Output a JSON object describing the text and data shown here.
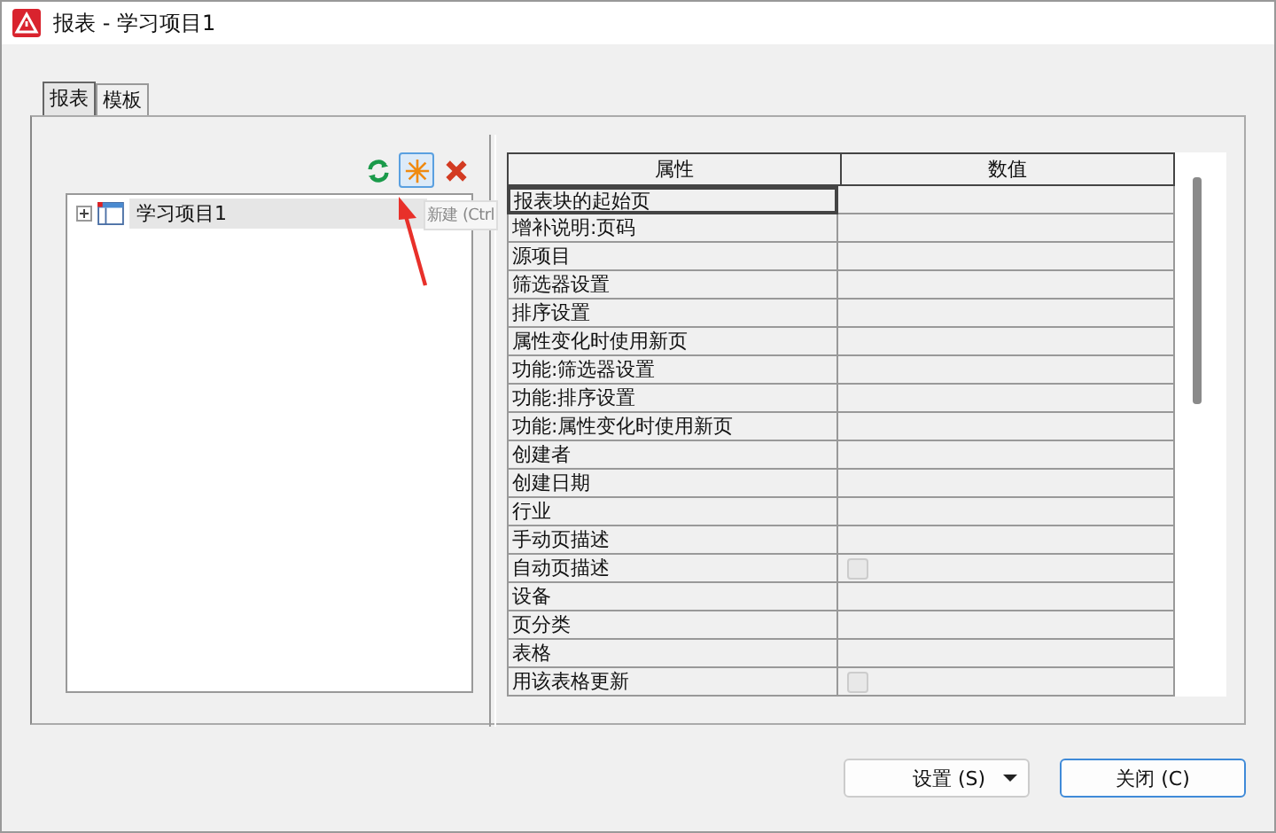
{
  "window": {
    "title": "报表 - 学习项目1"
  },
  "tabs": [
    {
      "label": "报表",
      "selected": true
    },
    {
      "label": "模板",
      "selected": false
    }
  ],
  "toolbar": {
    "tooltip": "新建 (Ctrl"
  },
  "tree": {
    "items": [
      {
        "label": "学习项目1",
        "expanded": false,
        "selected": true
      }
    ]
  },
  "table": {
    "columns": [
      "属性",
      "数值"
    ],
    "rows": [
      {
        "name": "报表块的起始页",
        "kind": "text",
        "selected": true
      },
      {
        "name": "增补说明:页码",
        "kind": "text",
        "selected": false
      },
      {
        "name": "源项目",
        "kind": "text",
        "selected": false
      },
      {
        "name": "筛选器设置",
        "kind": "text",
        "selected": false
      },
      {
        "name": "排序设置",
        "kind": "text",
        "selected": false
      },
      {
        "name": "属性变化时使用新页",
        "kind": "text",
        "selected": false
      },
      {
        "name": "功能:筛选器设置",
        "kind": "text",
        "selected": false
      },
      {
        "name": "功能:排序设置",
        "kind": "text",
        "selected": false
      },
      {
        "name": "功能:属性变化时使用新页",
        "kind": "text",
        "selected": false
      },
      {
        "name": "创建者",
        "kind": "text",
        "selected": false
      },
      {
        "name": "创建日期",
        "kind": "text",
        "selected": false
      },
      {
        "name": "行业",
        "kind": "text",
        "selected": false
      },
      {
        "name": "手动页描述",
        "kind": "text",
        "selected": false
      },
      {
        "name": "自动页描述",
        "kind": "checkbox",
        "checked": false,
        "selected": false
      },
      {
        "name": "设备",
        "kind": "text",
        "selected": false
      },
      {
        "name": "页分类",
        "kind": "text",
        "selected": false
      },
      {
        "name": "表格",
        "kind": "text",
        "selected": false
      },
      {
        "name": "用该表格更新",
        "kind": "checkbox",
        "checked": false,
        "selected": false
      }
    ]
  },
  "buttons": [
    {
      "label": "设置 (S)",
      "kind": "split"
    },
    {
      "label": "关闭 (C)",
      "kind": "default"
    }
  ]
}
